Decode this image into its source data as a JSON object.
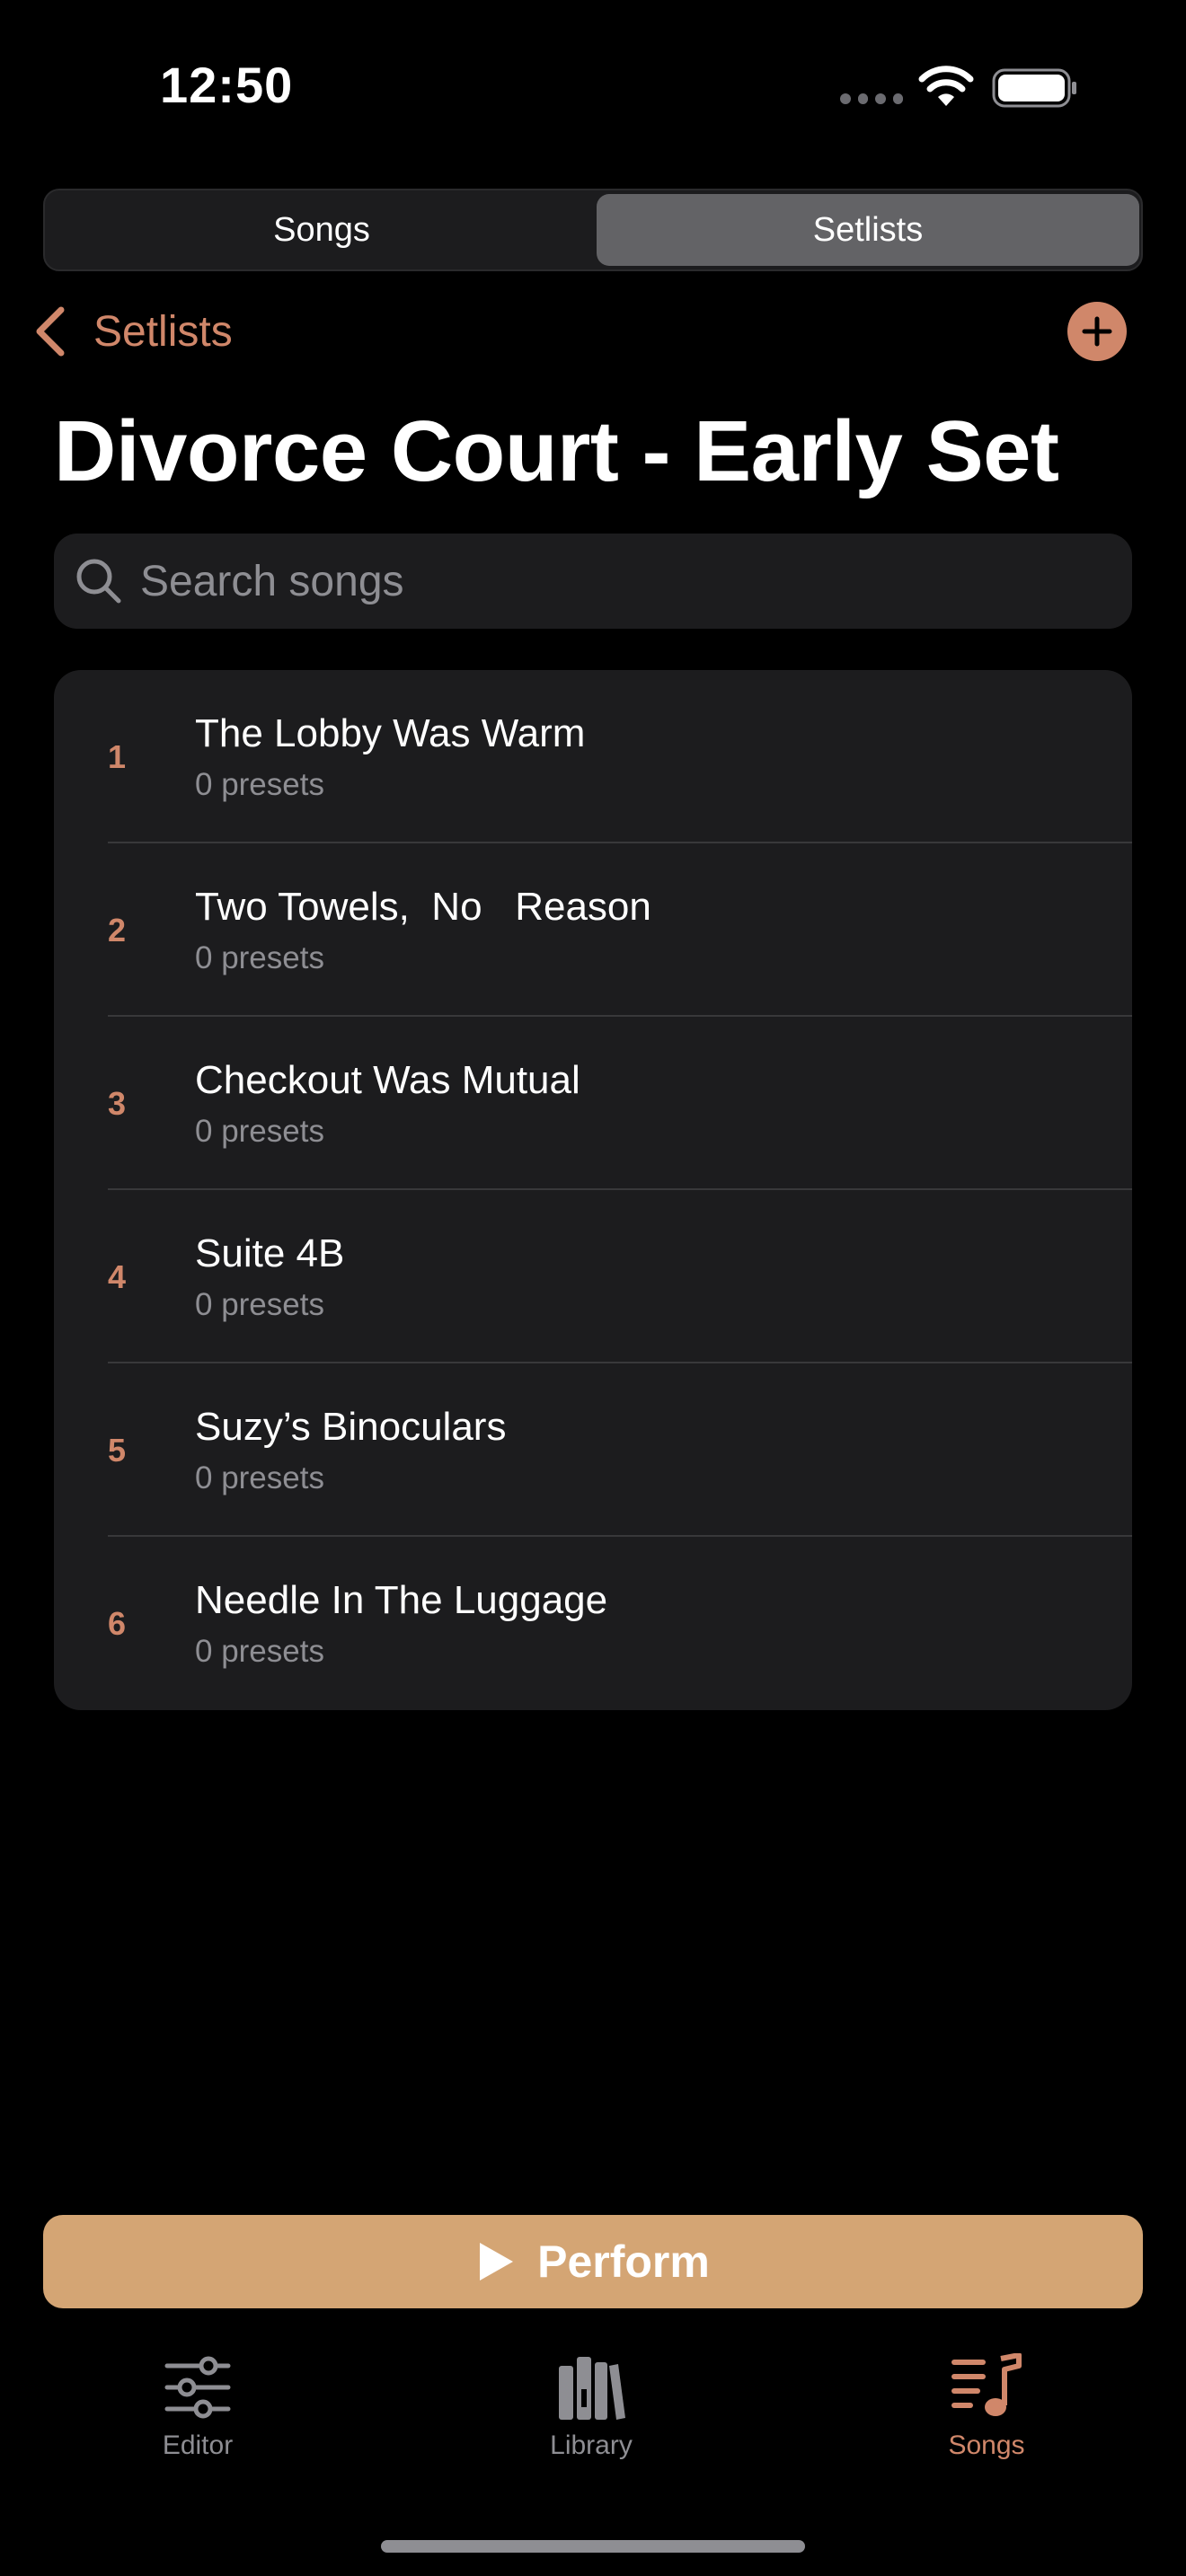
{
  "status": {
    "time": "12:50"
  },
  "segments": {
    "left": "Songs",
    "right": "Setlists"
  },
  "nav": {
    "back_label": "Setlists"
  },
  "title": "Divorce Court - Early Set",
  "search": {
    "placeholder": "Search songs"
  },
  "songs": [
    {
      "num": "1",
      "name": "The Lobby Was Warm",
      "sub": "0 presets"
    },
    {
      "num": "2",
      "name": "Two Towels,  No   Reason",
      "sub": "0 presets"
    },
    {
      "num": "3",
      "name": "Checkout Was Mutual",
      "sub": "0 presets"
    },
    {
      "num": "4",
      "name": "Suite 4B",
      "sub": "0 presets"
    },
    {
      "num": "5",
      "name": "Suzy’s Binoculars",
      "sub": "0 presets"
    },
    {
      "num": "6",
      "name": "Needle In The Luggage",
      "sub": "0 presets"
    }
  ],
  "perform": {
    "label": "Perform"
  },
  "tabs": {
    "editor": "Editor",
    "library": "Library",
    "songs": "Songs"
  },
  "colors": {
    "accent": "#d0876a",
    "perform": "#d4a574",
    "background": "#000000",
    "card": "#1c1c1e"
  },
  "icons": [
    "wifi-icon",
    "battery-icon",
    "chevron-left-icon",
    "plus-icon",
    "search-icon",
    "play-icon",
    "sliders-icon",
    "books-icon",
    "music-list-icon"
  ]
}
